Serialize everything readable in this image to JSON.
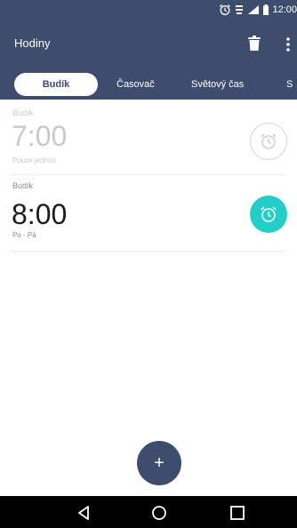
{
  "status_bar": {
    "time": "12:00",
    "icons": [
      "alarm-icon",
      "signal-icon",
      "battery-icon"
    ]
  },
  "app_bar": {
    "title": "Hodiny",
    "actions": [
      "trash-icon",
      "more-vert-icon"
    ]
  },
  "tabs": [
    {
      "label": "Budík",
      "active": true
    },
    {
      "label": "Časovač",
      "active": false
    },
    {
      "label": "Světový čas",
      "active": false
    },
    {
      "label": "S",
      "active": false
    }
  ],
  "alarms": [
    {
      "label": "Budík",
      "time": "7:00",
      "repeat": "Pouze jednou",
      "enabled": false
    },
    {
      "label": "Budík",
      "time": "8:00",
      "repeat": "Po - Pá",
      "enabled": true
    }
  ],
  "fab": {
    "label": "+"
  },
  "nav_bar": {
    "buttons": [
      "back-icon",
      "home-icon",
      "recents-icon"
    ]
  },
  "colors": {
    "header": "#3e4d6e",
    "accent_on": "#22cfc8",
    "disabled_text": "#c9c9c9"
  }
}
